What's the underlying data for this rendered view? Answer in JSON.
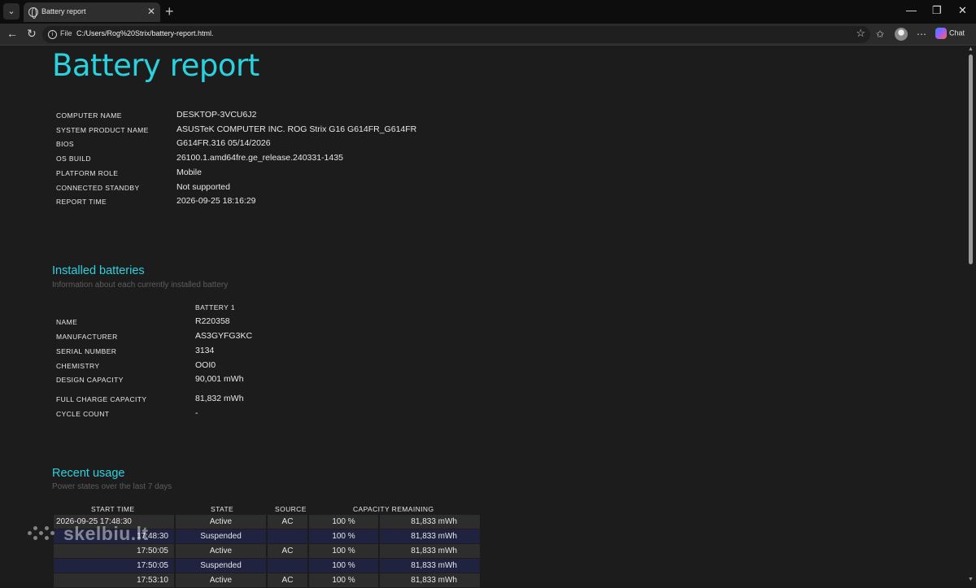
{
  "browser": {
    "tab_title": "Battery report",
    "new_tab": "+",
    "address_scheme": "File",
    "address_url": "C:/Users/Rog%20Strix/battery-report.html.",
    "chat_label": "Chat"
  },
  "report": {
    "title": "Battery report",
    "system_info": [
      {
        "label": "COMPUTER NAME",
        "value": "DESKTOP-3VCU6J2"
      },
      {
        "label": "SYSTEM PRODUCT NAME",
        "value": "ASUSTeK COMPUTER INC. ROG Strix G16 G614FR_G614FR"
      },
      {
        "label": "BIOS",
        "value": "G614FR.316 05/14/2026"
      },
      {
        "label": "OS BUILD",
        "value": "26100.1.amd64fre.ge_release.240331-1435"
      },
      {
        "label": "PLATFORM ROLE",
        "value": "Mobile"
      },
      {
        "label": "CONNECTED STANDBY",
        "value": "Not supported"
      },
      {
        "label": "REPORT TIME",
        "value": "2026-09-25  18:16:29"
      }
    ]
  },
  "installed": {
    "heading": "Installed batteries",
    "subtitle": "Information about each currently installed battery",
    "column": "BATTERY 1",
    "rows": [
      {
        "label": "NAME",
        "value": "R220358"
      },
      {
        "label": "MANUFACTURER",
        "value": "AS3GYFG3KC"
      },
      {
        "label": "SERIAL NUMBER",
        "value": "3134"
      },
      {
        "label": "CHEMISTRY",
        "value": "OOI0"
      },
      {
        "label": "DESIGN CAPACITY",
        "value": "90,001 mWh"
      },
      {
        "label": "FULL CHARGE CAPACITY",
        "value": "81,832 mWh"
      },
      {
        "label": "CYCLE COUNT",
        "value": "-"
      }
    ]
  },
  "recent": {
    "heading": "Recent usage",
    "subtitle": "Power states over the last 7 days",
    "columns": [
      "START TIME",
      "STATE",
      "SOURCE",
      "CAPACITY REMAINING"
    ],
    "rows": [
      {
        "start": "2026-09-25  17:48:30",
        "state": "Active",
        "source": "AC",
        "pct": "100 %",
        "mwh": "81,833 mWh"
      },
      {
        "start": "17:48:30",
        "state": "Suspended",
        "source": "",
        "pct": "100 %",
        "mwh": "81,833 mWh"
      },
      {
        "start": "17:50:05",
        "state": "Active",
        "source": "AC",
        "pct": "100 %",
        "mwh": "81,833 mWh"
      },
      {
        "start": "17:50:05",
        "state": "Suspended",
        "source": "",
        "pct": "100 %",
        "mwh": "81,833 mWh"
      },
      {
        "start": "17:53:10",
        "state": "Active",
        "source": "AC",
        "pct": "100 %",
        "mwh": "81,833 mWh"
      }
    ]
  },
  "watermark": "skelbiu.lt"
}
